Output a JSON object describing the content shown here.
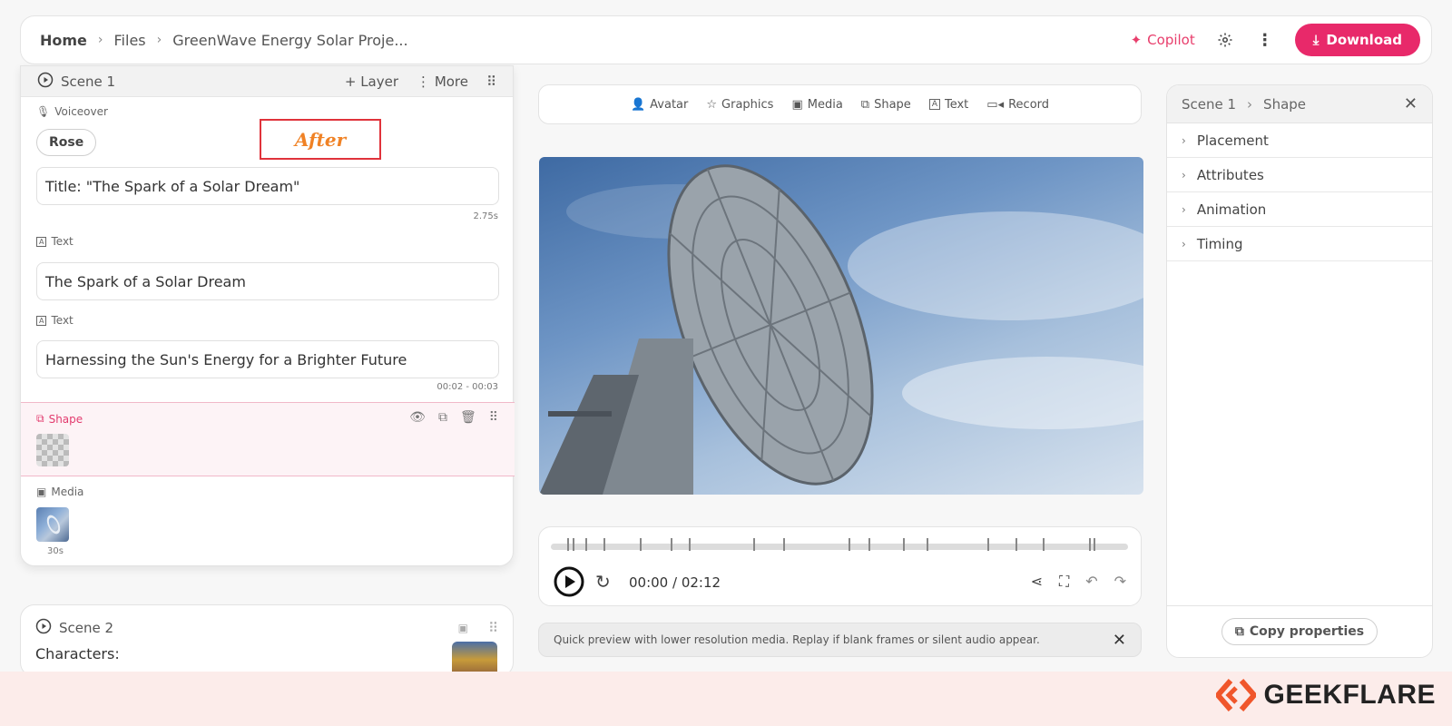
{
  "header": {
    "breadcrumbs": [
      "Home",
      "Files",
      "GreenWave Energy Solar Proje..."
    ],
    "copilot_label": "Copilot",
    "download_label": "Download"
  },
  "left": {
    "scene_title": "Scene 1",
    "layer_label": "Layer",
    "more_label": "More",
    "voiceover_label": "Voiceover",
    "voice_name": "Rose",
    "annotation": "After",
    "voiceover_text": "Title: \"The Spark of a Solar Dream\"",
    "voiceover_duration": "2.75s",
    "text1_label": "Text",
    "text1_value": "The Spark of a Solar Dream",
    "text2_label": "Text",
    "text2_value": "Harnessing the Sun's Energy for a Brighter Future",
    "text2_timing": "00:02 - 00:03",
    "shape_label": "Shape",
    "media_label": "Media",
    "media_duration": "30s"
  },
  "scene2": {
    "title": "Scene 2",
    "text": "Characters:"
  },
  "toolbar": {
    "items": [
      "Avatar",
      "Graphics",
      "Media",
      "Shape",
      "Text",
      "Record"
    ]
  },
  "player": {
    "time": "00:00 / 02:12"
  },
  "banner": {
    "text": "Quick preview with lower resolution media. Replay if blank frames or silent audio appear."
  },
  "right": {
    "crumb1": "Scene 1",
    "crumb2": "Shape",
    "sections": [
      "Placement",
      "Attributes",
      "Animation",
      "Timing"
    ],
    "copy_label": "Copy properties"
  },
  "brand": {
    "name": "GEEKFLARE",
    "color": "#f0562b"
  }
}
